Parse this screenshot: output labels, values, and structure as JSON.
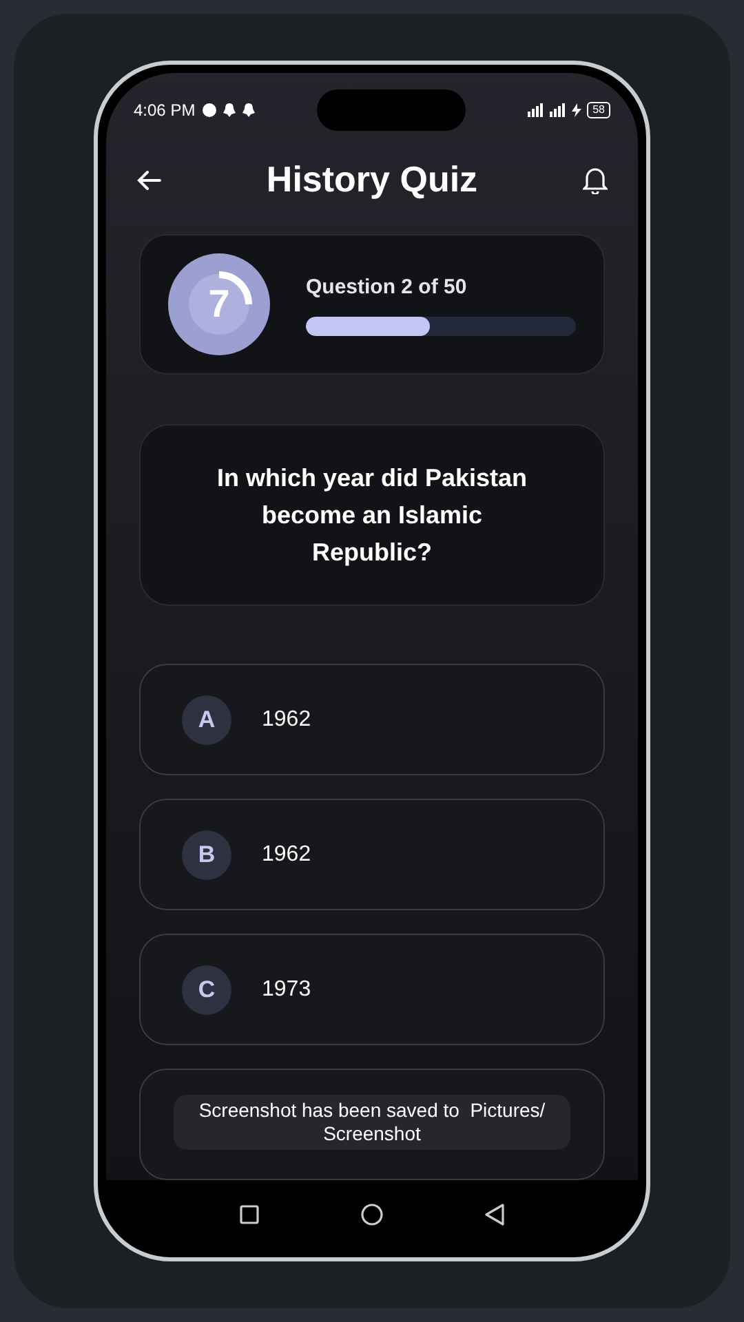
{
  "status_bar": {
    "time": "4:06 PM",
    "battery": "58"
  },
  "header": {
    "title": "History Quiz"
  },
  "progress": {
    "timer": "7",
    "label": "Question 2 of 50",
    "level": 0.46
  },
  "question": {
    "text": "In which year did Pakistan become an Islamic Republic?"
  },
  "options": [
    {
      "letter": "A",
      "text": "1962",
      "selected": false
    },
    {
      "letter": "B",
      "text": "1962",
      "selected": false
    },
    {
      "letter": "C",
      "text": "1973",
      "selected": false
    }
  ],
  "toast": {
    "text": "Screenshot has been saved to  Pictures/ Screenshot"
  }
}
